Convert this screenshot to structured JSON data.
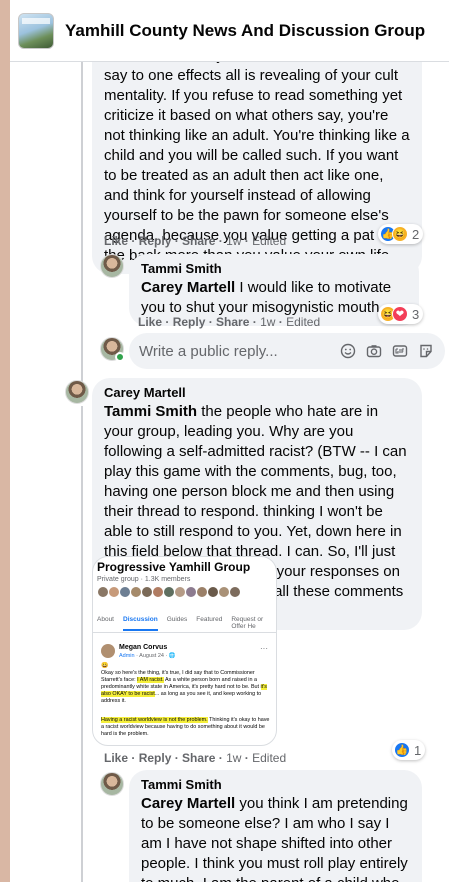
{
  "header": {
    "group_name": "Yamhill County News And Discussion Group"
  },
  "comment1": {
    "text": "do. The fact that you seem to believe what I say to one effects all is revealing of your cult mentality. If you refuse to read something yet criticize it based on what others say, you're not thinking like an adult. You're thinking like a child and you will be called such. If you want to be treated as an adult then act like one, and think for yourself instead of allowing yourself to be the pawn for someone else's agenda, because you value getting a pat on the back more than you value your own life.",
    "like": "Like",
    "reply": "Reply",
    "share": "Share",
    "time": "1w",
    "edited": "Edited",
    "reaction_count": "2"
  },
  "reply1": {
    "author": "Tammi Smith",
    "tag": "Carey Martell",
    "text": " I would like to motivate you to shut your misogynistic mouth.",
    "like": "Like",
    "reply": "Reply",
    "share": "Share",
    "time": "1w",
    "edited": "Edited",
    "reaction_count": "3"
  },
  "reply_box": {
    "placeholder": "Write a public reply..."
  },
  "comment2": {
    "author": "Carey Martell",
    "tag": "Tammi Smith",
    "text": " the people who hate are in your group, leading you. Why are you following a self-admitted racist? (BTW -- I can play this game with the comments, bug, too, having one person block me and then using their thread to respond. thinking I won't be able to still respond to you. Yet, down here in this field below that thread. I can. So, I'll just edit my responses in with your responses on the article I ultimately put all these comments into)",
    "like": "Like",
    "reply": "Reply",
    "share": "Share",
    "time": "1w",
    "edited": "Edited",
    "reaction_count": "1"
  },
  "attached_screenshot": {
    "group_title": "Progressive Yamhill Group",
    "group_sub": "Private group · 1.3K members",
    "tabs": [
      "About",
      "Discussion",
      "Guides",
      "Featured",
      "Request or Offer He"
    ],
    "poster": "Megan Corvus",
    "poster_role": "Admin",
    "poster_date": " · August 24 · ",
    "body_a": "Okay so here's the thing, it's true, I did say that to Commissioner Starrett's face: ",
    "body_hl1": "I AM racist.",
    "body_b": " As a white person born and raised in a predominantly white state in America, it's pretty hard not to be. But ",
    "body_hl2": "it's also OKAY to be racist",
    "body_c": "... as long as you see it, and keep working to address it.",
    "body_hl3": "Having a racist worldview is not the problem.",
    "body_d": " Thinking it's okay to have a racist worldview because having to do something about it would be hard is the problem."
  },
  "reply2": {
    "author": "Tammi Smith",
    "tag": "Carey Martell",
    "text": " you think I am pretending to be someone else? I am who I say I am I have not shape shifted into other people. I think you must roll play entirely to much. I am the parent of a child who no longer attends NHS."
  }
}
